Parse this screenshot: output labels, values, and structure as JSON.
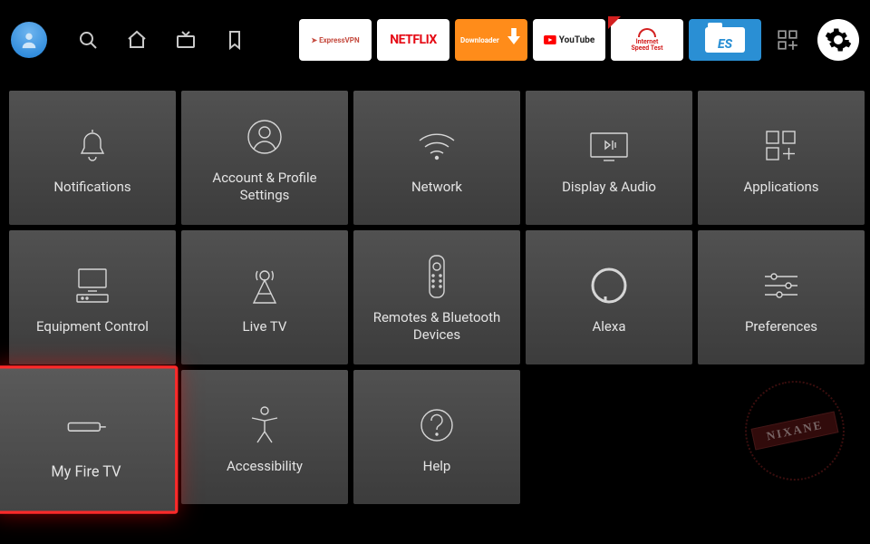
{
  "topApps": {
    "expressvpn": "ExpressVPN",
    "netflix": "NETFLIX",
    "downloader": "Downloader",
    "youtube": "YouTube",
    "speedtest_l1": "Internet",
    "speedtest_l2": "Speed Test",
    "es": "ES"
  },
  "tiles": {
    "notifications": "Notifications",
    "account": "Account & Profile Settings",
    "network": "Network",
    "display": "Display & Audio",
    "applications": "Applications",
    "equipment": "Equipment Control",
    "livetv": "Live TV",
    "remotes": "Remotes & Bluetooth Devices",
    "alexa": "Alexa",
    "preferences": "Preferences",
    "myfiretv": "My Fire TV",
    "accessibility": "Accessibility",
    "help": "Help"
  },
  "selected_tile": "myfiretv",
  "watermark": "NIXANE"
}
